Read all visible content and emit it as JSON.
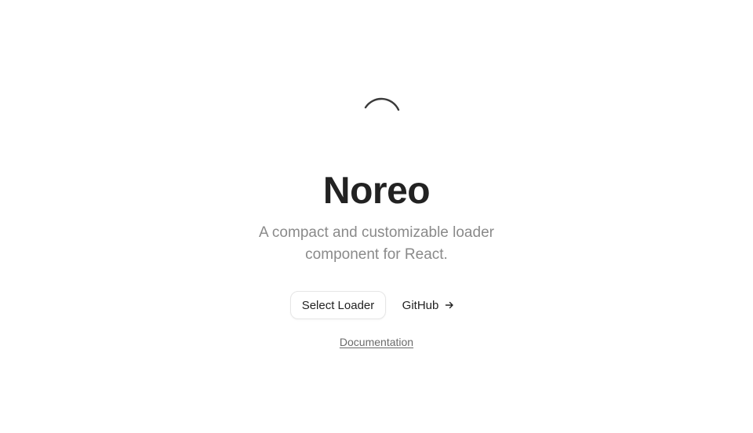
{
  "hero": {
    "loader_icon": "spinner-arc-icon",
    "title": "Noreo",
    "subtitle": "A compact and customizable loader component for React."
  },
  "actions": {
    "select_loader_label": "Select Loader",
    "github_label": "GitHub",
    "github_icon": "arrow-right-icon"
  },
  "footer_link": {
    "label": "Documentation"
  },
  "colors": {
    "background": "#ffffff",
    "title": "#222222",
    "subtitle": "#8a8a8a",
    "link": "#6b6b6b",
    "button_border": "#e6e6e6"
  }
}
